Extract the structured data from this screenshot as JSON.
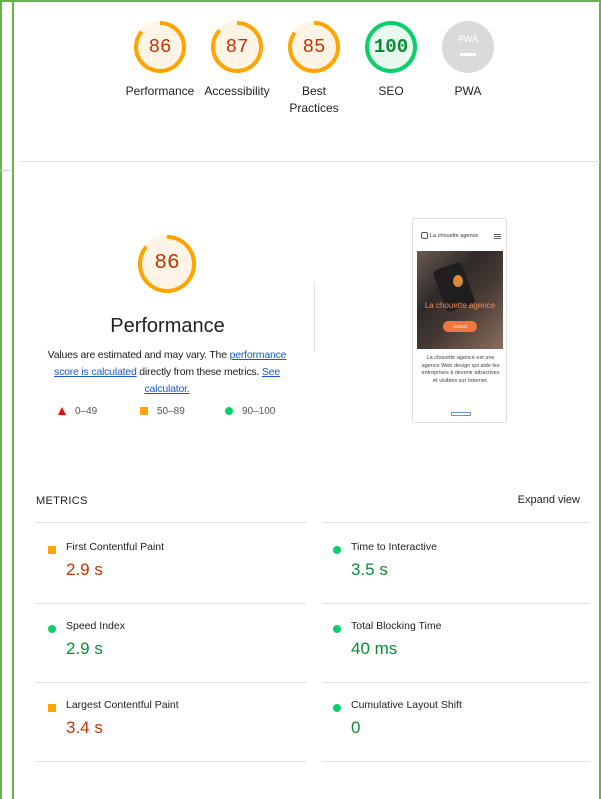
{
  "categories": [
    {
      "id": "performance",
      "score": "86",
      "label": "Performance",
      "rating": "average",
      "value": 86
    },
    {
      "id": "accessibility",
      "score": "87",
      "label": "Accessibility",
      "rating": "average",
      "value": 87
    },
    {
      "id": "best-practices",
      "score": "85",
      "label": "Best Practices",
      "rating": "average",
      "value": 85
    },
    {
      "id": "seo",
      "score": "100",
      "label": "SEO",
      "rating": "pass",
      "value": 100
    },
    {
      "id": "pwa",
      "score": "PWA",
      "label": "PWA",
      "rating": "na",
      "value": 0
    }
  ],
  "performance": {
    "score": "86",
    "value": 86,
    "title": "Performance",
    "desc_1": "Values are estimated and may vary. The ",
    "link_score": "performance score is calculated",
    "desc_2": " directly from these metrics. ",
    "link_calc": "See calculator."
  },
  "legend": {
    "fail": "0–49",
    "average": "50–89",
    "pass": "90–100"
  },
  "preview": {
    "brand": "La chouette agence",
    "hero_title": "La chouette agence",
    "cta": "contact",
    "body": "La chouette agence est une agence Web design qui aide les entreprises à devenir attractives et visibles sur Internet."
  },
  "metrics": {
    "title": "METRICS",
    "expand": "Expand view",
    "items": [
      {
        "name": "First Contentful Paint",
        "value": "2.9 s",
        "rating": "average"
      },
      {
        "name": "Time to Interactive",
        "value": "3.5 s",
        "rating": "pass"
      },
      {
        "name": "Speed Index",
        "value": "2.9 s",
        "rating": "pass"
      },
      {
        "name": "Total Blocking Time",
        "value": "40 ms",
        "rating": "pass"
      },
      {
        "name": "Largest Contentful Paint",
        "value": "3.4 s",
        "rating": "average"
      },
      {
        "name": "Cumulative Layout Shift",
        "value": "0",
        "rating": "pass"
      }
    ]
  },
  "colors": {
    "average": "#ffa400",
    "average_text": "#c33300",
    "pass": "#0cce6b",
    "pass_text": "#0c8b35",
    "fail": "#eb0f00",
    "na": "#cccccc",
    "link": "#1a57c9",
    "frame": "#6ab04c"
  }
}
